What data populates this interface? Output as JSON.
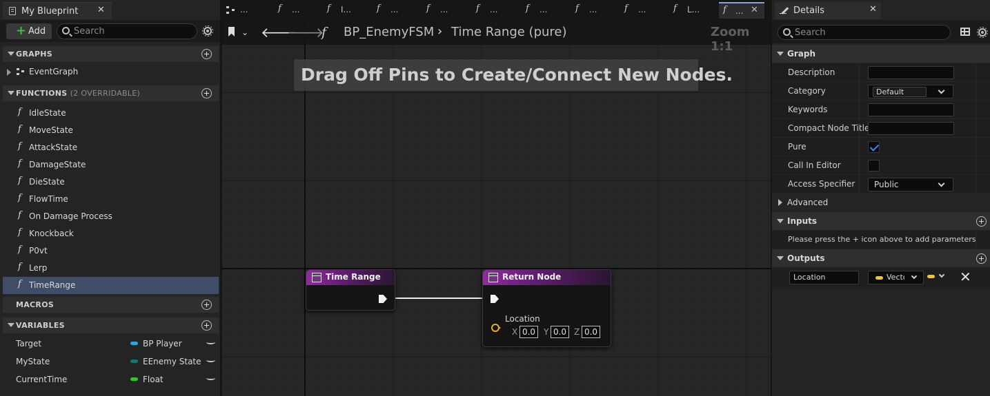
{
  "colors": {
    "selection": "#3f4e66",
    "pure_node_header": "#8e2c9e",
    "vector_pin": "#e0b22a",
    "object_var": "#2aa6e0",
    "enum_var": "#0f7a6a",
    "float_var": "#38c22a",
    "add_button_plus": "#3fbd3f",
    "checkbox_check": "#3a8ce8"
  },
  "left_panel": {
    "tab_title": "My Blueprint",
    "tab_close": "✕",
    "add_label": "Add",
    "search_placeholder": "Search",
    "graphs": {
      "title": "GRAPHS",
      "items": [
        {
          "label": "EventGraph"
        }
      ]
    },
    "functions": {
      "title": "FUNCTIONS",
      "subtitle": "(2 OVERRIDABLE)",
      "items": [
        {
          "label": "IdleState"
        },
        {
          "label": "MoveState"
        },
        {
          "label": "AttackState"
        },
        {
          "label": "DamageState"
        },
        {
          "label": "DieState"
        },
        {
          "label": "FlowTime"
        },
        {
          "label": "On Damage Process"
        },
        {
          "label": "Knockback"
        },
        {
          "label": "P0vt"
        },
        {
          "label": "Lerp"
        },
        {
          "label": "TimeRange",
          "selected": true
        }
      ]
    },
    "macros": {
      "title": "MACROS"
    },
    "variables": {
      "title": "VARIABLES",
      "items": [
        {
          "name": "Target",
          "type": "BP Player"
        },
        {
          "name": "MyState",
          "type": "EEnemy State"
        },
        {
          "name": "CurrentTime",
          "type": "Float"
        }
      ]
    }
  },
  "tabs": [
    {
      "icon": "event-graph-icon",
      "label": "..."
    },
    {
      "icon": "function-icon",
      "label": "..."
    },
    {
      "icon": "function-icon",
      "label": "I..."
    },
    {
      "icon": "function-icon",
      "label": "..."
    },
    {
      "icon": "function-icon",
      "label": "..."
    },
    {
      "icon": "function-icon",
      "label": "..."
    },
    {
      "icon": "function-icon",
      "label": "..."
    },
    {
      "icon": "function-icon",
      "label": "..."
    },
    {
      "icon": "function-icon",
      "label": "..."
    },
    {
      "icon": "function-icon",
      "label": "L..."
    },
    {
      "icon": "function-icon",
      "label": "...",
      "active": true
    }
  ],
  "graph": {
    "breadcrumb_blueprint": "BP_EnemyFSM",
    "breadcrumb_function": "Time Range (pure)",
    "zoom": "Zoom 1:1",
    "hint": "Drag Off Pins to Create/Connect New Nodes.",
    "nodes": {
      "entry": {
        "title": "Time Range"
      },
      "return": {
        "title": "Return Node",
        "pin_label": "Location",
        "x_axis": "X",
        "x_value": "0.0",
        "y_axis": "Y",
        "y_value": "0.0",
        "z_axis": "Z",
        "z_value": "0.0"
      }
    }
  },
  "details": {
    "tab_title": "Details",
    "tab_close": "✕",
    "search_placeholder": "Search",
    "graph_section": "Graph",
    "properties": {
      "description": "Description",
      "category": "Category",
      "category_value": "Default",
      "keywords": "Keywords",
      "compact_node_title": "Compact Node Title",
      "pure": "Pure",
      "pure_checked": true,
      "call_in_editor": "Call In Editor",
      "call_in_editor_checked": false,
      "access_specifier": "Access Specifier",
      "access_value": "Public"
    },
    "advanced": "Advanced",
    "inputs": {
      "title": "Inputs",
      "note": "Please press the + icon above to add parameters"
    },
    "outputs": {
      "title": "Outputs",
      "name": "Location",
      "type": "Vecto",
      "remove": "✕"
    }
  }
}
